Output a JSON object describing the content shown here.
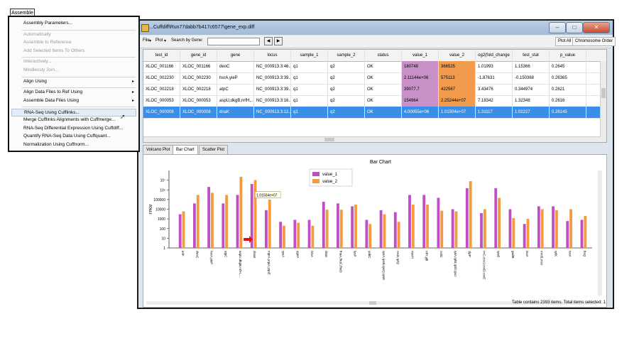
{
  "window": {
    "title": "...Cuffdiff\\Run77dabb7b417c6577\\gene_exp.diff",
    "buttons": {
      "minimize": "–",
      "maximize": "□",
      "close": "✕"
    }
  },
  "toolbar": {
    "file": "File",
    "plot": "Plot",
    "search_label": "Search by Gene:",
    "search_value": "",
    "prev": "◀",
    "next": "▶",
    "plot_all": "Plot All",
    "chromosome_order": "Chromosome Order"
  },
  "table": {
    "columns": [
      "test_id",
      "gene_id",
      "gene",
      "locus",
      "sample_1",
      "sample_2",
      "status",
      "value_1",
      "value_2",
      "og2(fold_change",
      "test_stat",
      "p_value"
    ],
    "rows": [
      [
        "XLOC_001166",
        "XLOC_001166",
        "deoC",
        "NC_000913.3:46...",
        "q1",
        "q2",
        "OK",
        "180748",
        "366525",
        "1.01993",
        "1.15366",
        "0.2645"
      ],
      [
        "XLOC_002230",
        "XLOC_002230",
        "hsrA,yieP",
        "NC_000913.3:39...",
        "q1",
        "q2",
        "OK",
        "2.11144e+06",
        "575113",
        "-1.87631",
        "-0.150368",
        "0.26365"
      ],
      [
        "XLOC_002218",
        "XLOC_002218",
        "atpC",
        "NC_000913.3:39...",
        "q1",
        "q2",
        "OK",
        "39077.7",
        "422567",
        "3.43476",
        "0.344974",
        "0.2621"
      ],
      [
        "XLOC_000053",
        "XLOC_000053",
        "aspU,dkgB,nrfH,...",
        "NC_000913.3:16...",
        "q1",
        "q2",
        "OK",
        "154964",
        "2.25244e+07",
        "7.18342",
        "1.32348",
        "0.2616"
      ],
      [
        "XLOC_000008",
        "XLOC_000008",
        "dnaK",
        "NC_000913.3:12...",
        "q1",
        "q2",
        "OK",
        "4.00055e+06",
        "1.01504e+07",
        "1.31117",
        "1.02227",
        "0.26145"
      ]
    ],
    "selected_row": 4
  },
  "tabs": [
    "Volcano Plot",
    "Bar Chart",
    "Scatter Plot"
  ],
  "active_tab": 1,
  "tooltip": "1.01504e+07",
  "status_text": "Table contains 2393 items.  Total items selected: 1",
  "colors": {
    "value_1": "#c04fc6",
    "value_2": "#f59a3f",
    "selection": "#3a8ee8"
  },
  "menu": {
    "button": "Assemble",
    "items": [
      {
        "label": "Assembly Parameters...",
        "enabled": true
      },
      {
        "sep": true
      },
      {
        "label": "Automatically",
        "enabled": false
      },
      {
        "label": "Assemble to Reference",
        "enabled": false
      },
      {
        "label": "Add Selected Items To Others",
        "enabled": false
      },
      {
        "sep": true
      },
      {
        "label": "Interactively...",
        "enabled": false
      },
      {
        "label": "Mindlessly Join...",
        "enabled": false
      },
      {
        "sep": true
      },
      {
        "label": "Align Using",
        "enabled": true,
        "submenu": true
      },
      {
        "sep": true
      },
      {
        "label": "Align Data Files to Ref Using",
        "enabled": true,
        "submenu": true
      },
      {
        "label": "Assemble Data Files Using",
        "enabled": true,
        "submenu": true
      },
      {
        "sep": true
      },
      {
        "label": "RNA-Seq Using Cufflinks...",
        "enabled": true,
        "highlighted": true
      },
      {
        "label": "Merge Cufflinks Alignments with Cuffmerge...",
        "enabled": true
      },
      {
        "label": "RNA-Seq Differential Expression Using Cuffdiff...",
        "enabled": true
      },
      {
        "label": "Quantify RNA-Seq Data Using Cuffquant...",
        "enabled": true
      },
      {
        "label": "Normalization Using Cuffnorm...",
        "enabled": true
      }
    ]
  },
  "chart_data": {
    "type": "bar",
    "title": "Bar Chart",
    "ylabel": "FPKM",
    "yscale": "log",
    "ylim": [
      1,
      100000000
    ],
    "yticks": [
      "1",
      "10",
      "100",
      "1000",
      "10000",
      "100000",
      "10⁶",
      "10⁷"
    ],
    "legend_position": "top-center",
    "categories": [
      "infF",
      "deoC",
      "hsrA,yieP",
      "atpC",
      "aspU,dkgB,nrfH,...",
      "dnaK",
      "mprA,yqaA,yqaE",
      "rpsA",
      "ygeA",
      "hlnA",
      "rbsE",
      "fhuA,fhuC,fhuD",
      "lysP",
      "yabC",
      "rpsA,rpsB,rpsQ,rpsE",
      "recE,rplQ",
      "nuoH",
      "rrfH,yjfi",
      "nrdC",
      "rplA,rplB,rplD,rpsJ",
      "clpP",
      "rrrC,ccvJ,ccvD,ccvE",
      "rpsB",
      "gadB",
      "lexA",
      "mrcB,mrcI",
      "rplK",
      "tsxA",
      "ftsQ"
    ],
    "series": [
      {
        "name": "value_1",
        "values": [
          3000,
          40000,
          2000000,
          40000,
          300000,
          4000055,
          8000,
          500,
          800,
          800,
          60000,
          40000,
          20000,
          800,
          8000,
          5000,
          300000,
          300000,
          150000,
          10000,
          1500000,
          4000,
          1500000,
          10000,
          300,
          20000,
          20000,
          600,
          800
        ]
      },
      {
        "name": "value_2",
        "values": [
          6000,
          300000,
          500000,
          300000,
          22524400,
          10150400,
          100000,
          200,
          400,
          200,
          9000,
          9000,
          30000,
          300,
          3000,
          500,
          30000,
          30000,
          7000,
          6000,
          8000000,
          10000,
          150000,
          1200,
          1000,
          10000,
          8000,
          10000,
          2000
        ]
      }
    ]
  }
}
